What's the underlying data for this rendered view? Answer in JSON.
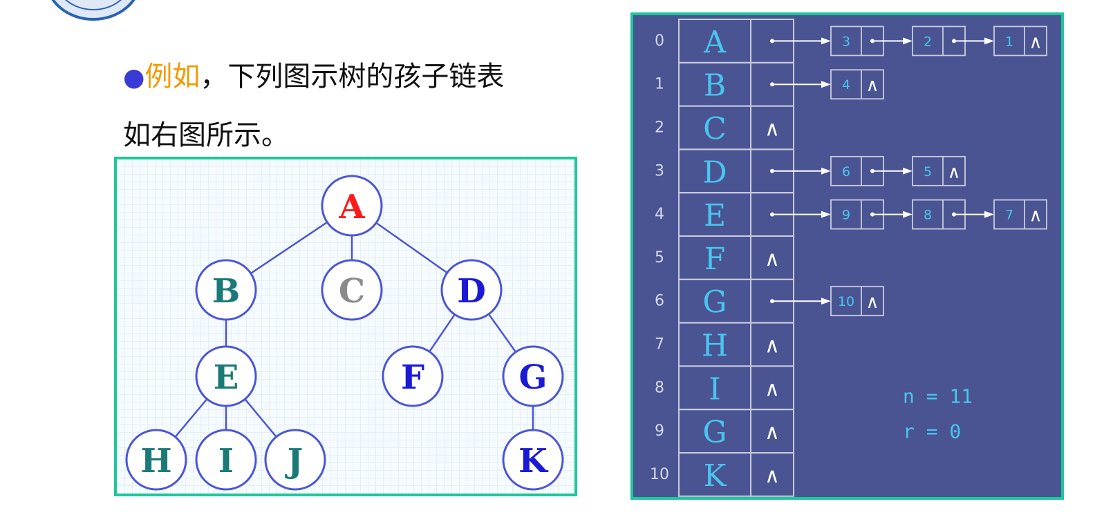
{
  "intro": {
    "bullet": "●",
    "highlight": "例如",
    "line1_rest": "，下列图示树的孩子链表",
    "line2": "如右图所示。"
  },
  "tree": {
    "nodes": [
      {
        "id": "A",
        "label": "A",
        "color": "#ff1a1a"
      },
      {
        "id": "B",
        "label": "B",
        "color": "#1a7a78"
      },
      {
        "id": "C",
        "label": "C",
        "color": "#8a8a8a"
      },
      {
        "id": "D",
        "label": "D",
        "color": "#1a1ad6"
      },
      {
        "id": "E",
        "label": "E",
        "color": "#1a7a78"
      },
      {
        "id": "F",
        "label": "F",
        "color": "#1a1ad6"
      },
      {
        "id": "G",
        "label": "G",
        "color": "#1a1ad6"
      },
      {
        "id": "H",
        "label": "H",
        "color": "#1a7a78"
      },
      {
        "id": "I",
        "label": "I",
        "color": "#1a7a78"
      },
      {
        "id": "J",
        "label": "J",
        "color": "#1a7a78"
      },
      {
        "id": "K",
        "label": "K",
        "color": "#1a1ad6"
      }
    ],
    "edges": [
      [
        "A",
        "B"
      ],
      [
        "A",
        "C"
      ],
      [
        "A",
        "D"
      ],
      [
        "B",
        "E"
      ],
      [
        "D",
        "F"
      ],
      [
        "D",
        "G"
      ],
      [
        "E",
        "H"
      ],
      [
        "E",
        "I"
      ],
      [
        "E",
        "J"
      ],
      [
        "G",
        "K"
      ]
    ]
  },
  "child_list": {
    "null_symbol": "∧",
    "rows": [
      {
        "index": "0",
        "letter": "A",
        "children": [
          "3",
          "2",
          "1"
        ]
      },
      {
        "index": "1",
        "letter": "B",
        "children": [
          "4"
        ]
      },
      {
        "index": "2",
        "letter": "C",
        "children": []
      },
      {
        "index": "3",
        "letter": "D",
        "children": [
          "6",
          "5"
        ]
      },
      {
        "index": "4",
        "letter": "E",
        "children": [
          "9",
          "8",
          "7"
        ]
      },
      {
        "index": "5",
        "letter": "F",
        "children": []
      },
      {
        "index": "6",
        "letter": "G",
        "children": [
          "10"
        ]
      },
      {
        "index": "7",
        "letter": "H",
        "children": []
      },
      {
        "index": "8",
        "letter": "I",
        "children": []
      },
      {
        "index": "9",
        "letter": "G",
        "children": []
      },
      {
        "index": "10",
        "letter": "K",
        "children": []
      }
    ],
    "params": [
      "n = 11",
      "r = 0"
    ]
  }
}
